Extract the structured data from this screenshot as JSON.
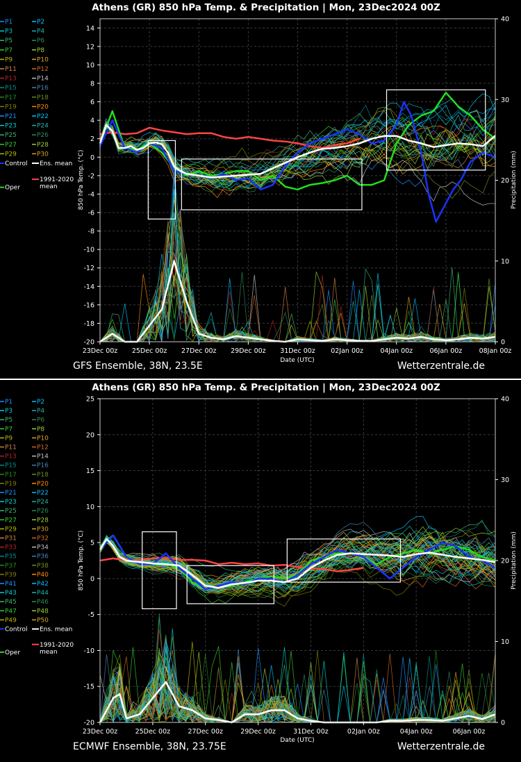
{
  "chart_data": [
    {
      "type": "line",
      "title": "Athens  (GR)  850 hPa Temp. & Precipitation | Mon, 23Dec2024 00Z",
      "xlabel": "Date (UTC)",
      "ylabel": "850 hPa Temp. (°C)",
      "y2label": "Precipitation (mm)",
      "footer_left": "GFS Ensemble, 38N, 23.5E",
      "footer_right": "Wetterzentrale.de",
      "x_ticks": [
        "23Dec 00z",
        "25Dec 00z",
        "27Dec 00z",
        "29Dec 00z",
        "31Dec 00z",
        "02Jan 00z",
        "04Jan 00z",
        "06Jan 00z",
        "08Jan 00z"
      ],
      "x_range_days": [
        0,
        16
      ],
      "ylim": [
        -20,
        15
      ],
      "y_ticks": [
        14,
        12,
        10,
        8,
        6,
        4,
        2,
        0,
        -2,
        -4,
        -6,
        -8,
        -10,
        -12,
        -14,
        -16,
        -18,
        -20
      ],
      "y2lim": [
        0,
        40
      ],
      "y2_ticks": [
        0,
        10,
        20,
        30,
        40
      ],
      "grid": true,
      "legend_placement": "left",
      "legend_members": [
        "P1",
        "P2",
        "P3",
        "P4",
        "P5",
        "P6",
        "P7",
        "P8",
        "P9",
        "P10",
        "P11",
        "P12",
        "P13",
        "P14",
        "P15",
        "P16",
        "P17",
        "P18",
        "P19",
        "P20",
        "P21",
        "P22",
        "P23",
        "P24",
        "P25",
        "P26",
        "P27",
        "P28",
        "P29",
        "P30"
      ],
      "legend_special": [
        "Control",
        "Ens. mean",
        "1991-2020\nmean",
        "Oper"
      ],
      "ens_mean": {
        "x": [
          0,
          0.25,
          0.5,
          0.75,
          1,
          1.25,
          1.5,
          1.75,
          2,
          2.25,
          2.5,
          2.75,
          3,
          3.25,
          3.5,
          3.75,
          4,
          4.5,
          5,
          5.5,
          6,
          6.5,
          7,
          7.5,
          8,
          8.5,
          9,
          9.5,
          10,
          10.5,
          11,
          11.5,
          12,
          12.5,
          13,
          13.5,
          14,
          14.5,
          15,
          15.5,
          16
        ],
        "y": [
          1.5,
          3.5,
          2.8,
          1.0,
          1.0,
          1.2,
          0.8,
          1.0,
          1.5,
          1.6,
          1.4,
          0.5,
          -1.0,
          -1.5,
          -1.8,
          -1.9,
          -2.0,
          -2.2,
          -2.1,
          -2.0,
          -1.9,
          -1.8,
          -1.2,
          -0.6,
          0.0,
          0.5,
          0.9,
          1.0,
          1.2,
          1.5,
          2.0,
          2.3,
          2.3,
          1.8,
          1.5,
          1.1,
          1.3,
          1.5,
          1.4,
          1.2,
          2.3
        ]
      },
      "control": {
        "x": [
          0,
          0.5,
          1,
          1.5,
          2,
          2.5,
          3,
          3.5,
          4,
          4.5,
          5,
          5.5,
          6,
          6.5,
          7,
          7.5,
          8,
          8.5,
          9,
          9.5,
          10,
          10.5,
          11,
          11.5,
          12,
          12.3,
          12.6,
          13,
          13.3,
          13.6,
          14,
          14.3,
          14.6,
          15,
          15.5,
          16
        ],
        "y": [
          1.2,
          4.0,
          1.0,
          0.5,
          1.5,
          1.0,
          -1.5,
          -1.8,
          -2.0,
          -2.3,
          -1.8,
          -2.5,
          -2.3,
          -3.5,
          -3.0,
          -1.0,
          0.5,
          1.5,
          2.0,
          2.5,
          3.0,
          2.5,
          1.5,
          1.8,
          3.5,
          6.0,
          4.5,
          0.5,
          -4.0,
          -7.0,
          -5.0,
          -3.5,
          -2.5,
          -0.5,
          0.5,
          0.0
        ]
      },
      "oper": {
        "x": [
          0,
          0.5,
          1,
          1.5,
          2,
          2.5,
          3,
          3.5,
          4,
          4.5,
          5,
          5.5,
          6,
          6.5,
          7,
          7.5,
          8,
          8.5,
          9,
          9.5,
          10,
          10.5,
          11,
          11.5,
          12,
          12.5,
          13,
          13.5,
          14,
          14.5,
          15,
          15.5,
          16
        ],
        "y": [
          1.5,
          5.0,
          1.0,
          0.8,
          1.5,
          0.5,
          -1.2,
          -2.0,
          -1.5,
          -2.0,
          -1.8,
          -1.5,
          -1.5,
          -2.5,
          -2.0,
          -3.2,
          -3.5,
          -3.0,
          -2.8,
          -2.5,
          -2.0,
          -3.0,
          -3.0,
          -2.5,
          1.5,
          3.5,
          4.5,
          5.0,
          7.0,
          5.5,
          4.5,
          3.0,
          2.0
        ]
      },
      "climate_mean": {
        "x": [
          0,
          0.5,
          1,
          1.5,
          2,
          2.5,
          3,
          3.5,
          4,
          4.5,
          5,
          5.5,
          6,
          6.5,
          7,
          7.5,
          8,
          8.5,
          9,
          9.5,
          10,
          10.5
        ],
        "y": [
          2.5,
          2.7,
          2.5,
          2.6,
          3.2,
          2.9,
          2.7,
          2.5,
          2.6,
          2.6,
          2.2,
          2.0,
          2.2,
          2.0,
          1.8,
          1.7,
          1.5,
          1.2,
          1.0,
          1.3,
          1.5,
          2.0
        ]
      },
      "ens_mean_precip": {
        "x": [
          0,
          0.5,
          1,
          1.5,
          2,
          2.5,
          3,
          3.5,
          4,
          4.5,
          5,
          5.5,
          6,
          6.5,
          7,
          7.5,
          8,
          8.5,
          9,
          9.5,
          10,
          10.5,
          11,
          11.5,
          12,
          12.5,
          13,
          13.5,
          14,
          14.5,
          15,
          15.5,
          16
        ],
        "y": [
          0,
          1,
          0,
          0,
          2,
          4,
          10,
          5,
          1,
          0.5,
          0.3,
          0.7,
          0.5,
          0.3,
          0.1,
          0,
          0.3,
          0.2,
          0.1,
          0.3,
          0.2,
          0.1,
          0.1,
          0.3,
          0.5,
          0.4,
          0.6,
          0.3,
          0.2,
          0.3,
          0.5,
          0.4,
          0.6
        ]
      },
      "highlight_boxes": [
        {
          "x": [
            1.95,
            3.05
          ],
          "y": [
            -6.7,
            1.8
          ]
        },
        {
          "x": [
            3.3,
            10.6
          ],
          "y": [
            -5.7,
            -0.2
          ]
        },
        {
          "x": [
            11.6,
            15.6
          ],
          "y": [
            -1.4,
            7.3
          ]
        }
      ]
    },
    {
      "type": "line",
      "title": "Athens  (GR)  850 hPa Temp. & Precipitation | Mon, 23Dec2024 00Z",
      "xlabel": "Date (UTC)",
      "ylabel": "850 hPa Temp. (°C)",
      "y2label": "Precipitation (mm)",
      "footer_left": "ECMWF Ensemble, 38N, 23.75E",
      "footer_right": "Wetterzentrale.de",
      "x_ticks": [
        "23Dec 00z",
        "25Dec 00z",
        "27Dec 00z",
        "29Dec 00z",
        "31Dec 00z",
        "02Jan 00z",
        "04Jan 00z",
        "06Jan 00z"
      ],
      "x_range_days": [
        0,
        15
      ],
      "ylim": [
        -20,
        25
      ],
      "y_ticks": [
        25,
        20,
        15,
        10,
        5,
        0,
        -5,
        -10,
        -15,
        -20
      ],
      "y2lim": [
        0,
        40
      ],
      "y2_ticks": [
        0,
        10,
        20,
        30,
        40
      ],
      "grid": true,
      "legend_placement": "left",
      "legend_members": [
        "P1",
        "P2",
        "P3",
        "P4",
        "P5",
        "P6",
        "P7",
        "P8",
        "P9",
        "P10",
        "P11",
        "P12",
        "P13",
        "P14",
        "P15",
        "P16",
        "P17",
        "P18",
        "P19",
        "P20",
        "P21",
        "P22",
        "P23",
        "P24",
        "P25",
        "P26",
        "P27",
        "P28",
        "P29",
        "P30",
        "P31",
        "P32",
        "P33",
        "P34",
        "P35",
        "P36",
        "P37",
        "P38",
        "P39",
        "P40",
        "P41",
        "P42",
        "P43",
        "P44",
        "P45",
        "P46",
        "P47",
        "P48",
        "P49",
        "P50"
      ],
      "legend_special": [
        "Control",
        "Ens. mean",
        "1991-2020\nmean",
        "Oper"
      ],
      "ens_mean": {
        "x": [
          0,
          0.25,
          0.5,
          0.75,
          1,
          1.5,
          2,
          2.5,
          3,
          3.5,
          4,
          4.5,
          5,
          5.5,
          6,
          6.5,
          7,
          7.5,
          8,
          8.5,
          9,
          9.5,
          10,
          10.5,
          11,
          11.5,
          12,
          12.5,
          13,
          13.5,
          14,
          14.5,
          15
        ],
        "y": [
          4.0,
          5.5,
          4.5,
          3.0,
          2.5,
          2.3,
          2.1,
          2.0,
          1.8,
          0.5,
          -1.0,
          -1.3,
          -0.8,
          -0.6,
          -0.3,
          -0.3,
          -0.5,
          0.0,
          1.5,
          2.5,
          3.3,
          3.5,
          3.4,
          3.3,
          3.2,
          3.0,
          3.4,
          3.6,
          3.3,
          3.0,
          2.8,
          2.6,
          2.3
        ]
      },
      "control": {
        "x": [
          0,
          0.5,
          1,
          1.5,
          2,
          2.5,
          3,
          3.5,
          4,
          4.5,
          5,
          5.5,
          6,
          6.5,
          7,
          7.5,
          8,
          8.5,
          9,
          9.5,
          10,
          10.5,
          11,
          11.5,
          12,
          12.5,
          13,
          13.5,
          14,
          14.5,
          15
        ],
        "y": [
          4.0,
          6.0,
          3.0,
          2.0,
          2.0,
          3.5,
          1.5,
          0.0,
          -1.5,
          -1.0,
          -0.5,
          -0.8,
          0.0,
          0.0,
          -0.5,
          0.5,
          2.0,
          3.0,
          4.0,
          3.5,
          3.0,
          1.5,
          0.0,
          1.5,
          3.0,
          4.0,
          5.0,
          4.5,
          3.0,
          2.5,
          1.5
        ]
      },
      "oper": {
        "x": [
          0,
          0.5,
          1,
          1.5,
          2,
          2.5,
          3,
          3.5,
          4,
          4.5,
          5,
          5.5,
          6,
          6.5,
          7,
          7.5,
          8,
          8.5,
          9,
          9.5,
          10,
          10.5,
          11,
          11.5,
          12,
          12.5,
          13,
          13.5,
          14,
          14.5,
          15
        ],
        "y": [
          4.5,
          6.0,
          3.0,
          2.0,
          2.0,
          2.0,
          1.5,
          -0.5,
          -1.5,
          -1.0,
          -1.0,
          -0.5,
          0.0,
          0.3,
          0.0,
          0.5,
          2.5,
          3.0,
          3.5,
          3.5,
          3.0,
          2.0,
          3.0,
          3.5,
          4.0,
          3.5,
          4.0,
          4.5,
          4.0,
          3.0,
          2.5
        ]
      },
      "climate_mean": {
        "x": [
          0,
          0.5,
          1,
          1.5,
          2,
          2.5,
          3,
          3.5,
          4,
          4.5,
          5,
          5.5,
          6,
          6.5,
          7,
          7.5,
          8,
          8.5,
          9,
          9.5,
          10
        ],
        "y": [
          2.5,
          2.8,
          2.5,
          2.6,
          2.8,
          2.9,
          2.6,
          2.6,
          2.5,
          2.0,
          2.2,
          2.0,
          2.1,
          1.8,
          1.9,
          1.6,
          1.4,
          1.3,
          1.0,
          1.2,
          1.5
        ]
      },
      "ens_mean_precip": {
        "x": [
          0,
          0.5,
          0.75,
          1,
          1.5,
          2,
          2.5,
          3,
          3.5,
          4,
          4.5,
          5,
          5.5,
          6,
          6.5,
          7,
          7.5,
          8,
          8.5,
          9,
          9.5,
          10,
          10.5,
          11,
          11.5,
          12,
          12.5,
          13,
          13.5,
          14,
          14.5,
          15
        ],
        "y": [
          0,
          3,
          3.5,
          0.5,
          1,
          3,
          5,
          2,
          1.5,
          0.5,
          0.3,
          0,
          1,
          1,
          1.5,
          1.5,
          0.5,
          0.2,
          0,
          0,
          0,
          0,
          0,
          0.2,
          0.2,
          0.3,
          0.3,
          0.2,
          0.5,
          0.8,
          0.4,
          1.0
        ]
      },
      "highlight_boxes": [
        {
          "x": [
            1.6,
            2.9
          ],
          "y": [
            -4.2,
            6.5
          ]
        },
        {
          "x": [
            3.3,
            6.6
          ],
          "y": [
            -3.5,
            1.8
          ]
        },
        {
          "x": [
            7.1,
            11.4
          ],
          "y": [
            -0.5,
            5.5
          ]
        }
      ]
    }
  ]
}
